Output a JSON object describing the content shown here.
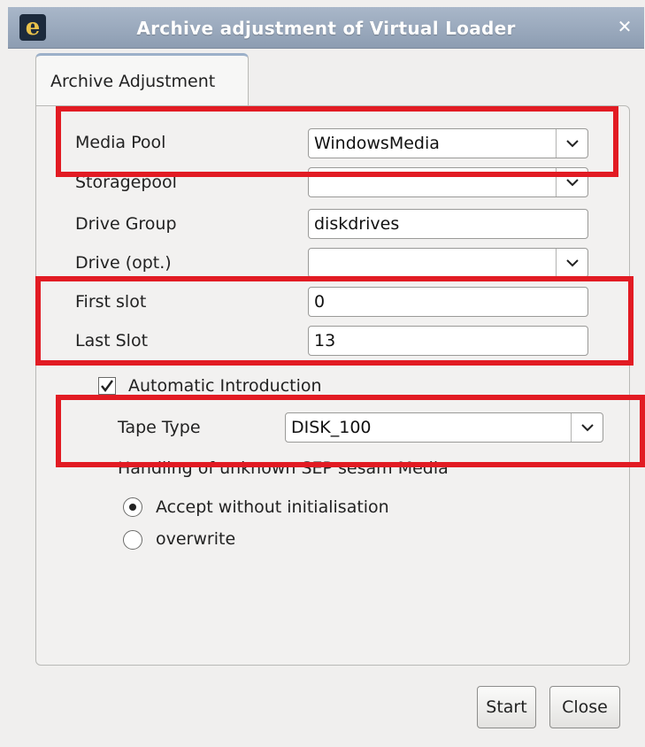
{
  "window": {
    "title": "Archive adjustment of Virtual Loader",
    "app_icon": "app-logo-icon",
    "close_glyph": "✕"
  },
  "tabs": [
    {
      "label": "Archive Adjustment",
      "selected": true
    }
  ],
  "form": {
    "media_pool": {
      "label": "Media Pool",
      "value": "WindowsMedia"
    },
    "storagepool": {
      "label": "Storagepool",
      "value": ""
    },
    "drive_group": {
      "label": "Drive Group",
      "value": "diskdrives"
    },
    "drive": {
      "label": "Drive (opt.)",
      "value": ""
    },
    "first_slot": {
      "label": "First slot",
      "value": "0"
    },
    "last_slot": {
      "label": "Last Slot",
      "value": "13"
    },
    "automatic_introduction": {
      "label": "Automatic Introduction",
      "checked": true
    },
    "tape_type": {
      "label": "Tape Type",
      "value": "DISK_100"
    },
    "unknown_media": {
      "label": "Handling of unknown SEP sesam Media",
      "options": [
        {
          "label": "Accept without initialisation",
          "selected": true
        },
        {
          "label": "overwrite",
          "selected": false
        }
      ]
    }
  },
  "buttons": {
    "start": "Start",
    "close": "Close"
  },
  "colors": {
    "highlight": "#e21b23",
    "titlebar": "#9aa9bd"
  }
}
